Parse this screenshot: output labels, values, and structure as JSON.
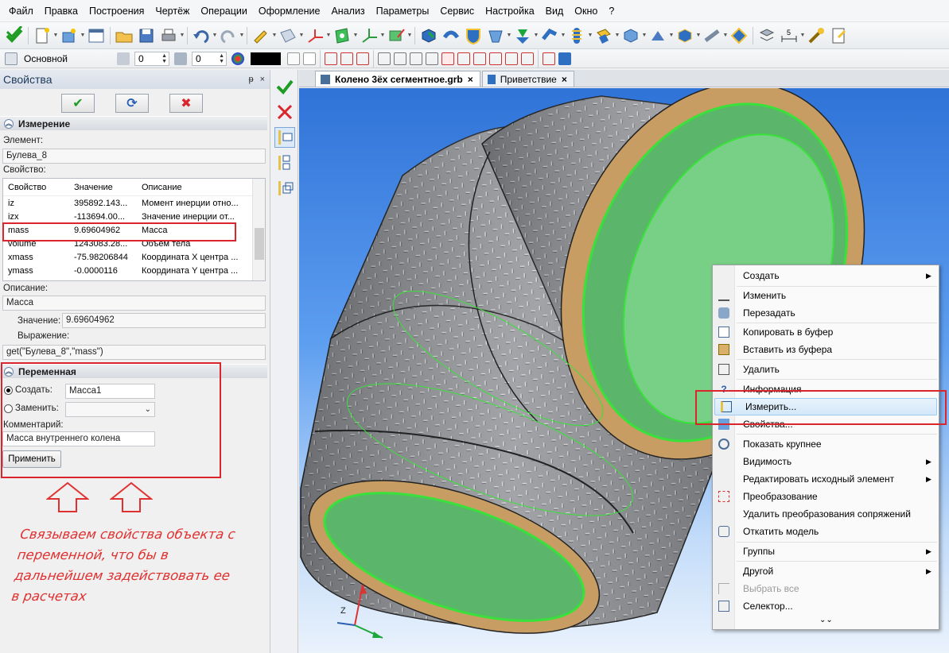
{
  "menubar": [
    "Файл",
    "Правка",
    "Построения",
    "Чертёж",
    "Операции",
    "Оформление",
    "Анализ",
    "Параметры",
    "Сервис",
    "Настройка",
    "Вид",
    "Окно",
    "?"
  ],
  "toolbar2": {
    "layer_name": "Основной",
    "spin1": "0",
    "spin2": "0"
  },
  "panel": {
    "title": "Свойства",
    "pin": "ᵽ",
    "close": "×",
    "section_measure": "Измерение",
    "element_label": "Элемент:",
    "element_value": "Булева_8",
    "property_label": "Свойство:",
    "table": {
      "headers": [
        "Свойство",
        "Значение",
        "Описание"
      ],
      "rows": [
        [
          "iz",
          "395892.143...",
          "Момент инерции отно..."
        ],
        [
          "izx",
          "-113694.00...",
          "Значение инерции от..."
        ],
        [
          "mass",
          "9.69604962",
          "Масса"
        ],
        [
          "volume",
          "1243083.28...",
          "Объём тела"
        ],
        [
          "xmass",
          "-75.98206844",
          "Координата X центра ..."
        ],
        [
          "ymass",
          "-0.0000116",
          "Координата Y центра ..."
        ]
      ]
    },
    "description_label": "Описание:",
    "description_value": "Масса",
    "value_label": "Значение:",
    "value_value": "9.69604962",
    "expression_label": "Выражение:",
    "expression_value": "get(\"Булева_8\",\"mass\")",
    "section_variable": "Переменная",
    "create_label": "Создать:",
    "create_value": "Масса1",
    "replace_label": "Заменить:",
    "comment_label": "Комментарий:",
    "comment_value": "Масса внутреннего колена",
    "apply_button": "Применить"
  },
  "annotation": [
    "Связываем свойства объекта с",
    "переменной, что бы в",
    "дальнейшем задействовать ее",
    "в расчетах"
  ],
  "tabs": [
    {
      "label": "Колено 3ёх сегментное.grb",
      "close": "×"
    },
    {
      "label": "Приветствие",
      "close": "×"
    }
  ],
  "axis": {
    "z": "Z"
  },
  "context_menu": [
    {
      "label": "Создать",
      "submenu": true
    },
    {
      "label": "Изменить"
    },
    {
      "label": "Перезадать"
    },
    {
      "label": "Копировать в буфер"
    },
    {
      "label": "Вставить из буфера"
    },
    {
      "label": "Удалить"
    },
    {
      "label": "Информация"
    },
    {
      "label": "Измерить..."
    },
    {
      "label": "Свойства..."
    },
    {
      "label": "Показать крупнее"
    },
    {
      "label": "Видимость",
      "submenu": true
    },
    {
      "label": "Редактировать исходный элемент",
      "submenu": true
    },
    {
      "label": "Преобразование"
    },
    {
      "label": "Удалить преобразования сопряжений"
    },
    {
      "label": "Откатить модель"
    },
    {
      "label": "Группы",
      "submenu": true
    },
    {
      "label": "Другой",
      "submenu": true
    },
    {
      "label": "Выбрать все",
      "disabled": true
    },
    {
      "label": "Селектор..."
    }
  ],
  "context_more": "⌄⌄",
  "colors": {
    "accent_red": "#d9252b",
    "highlight_green": "#39e23a",
    "viewport_top": "#2f73d8"
  }
}
